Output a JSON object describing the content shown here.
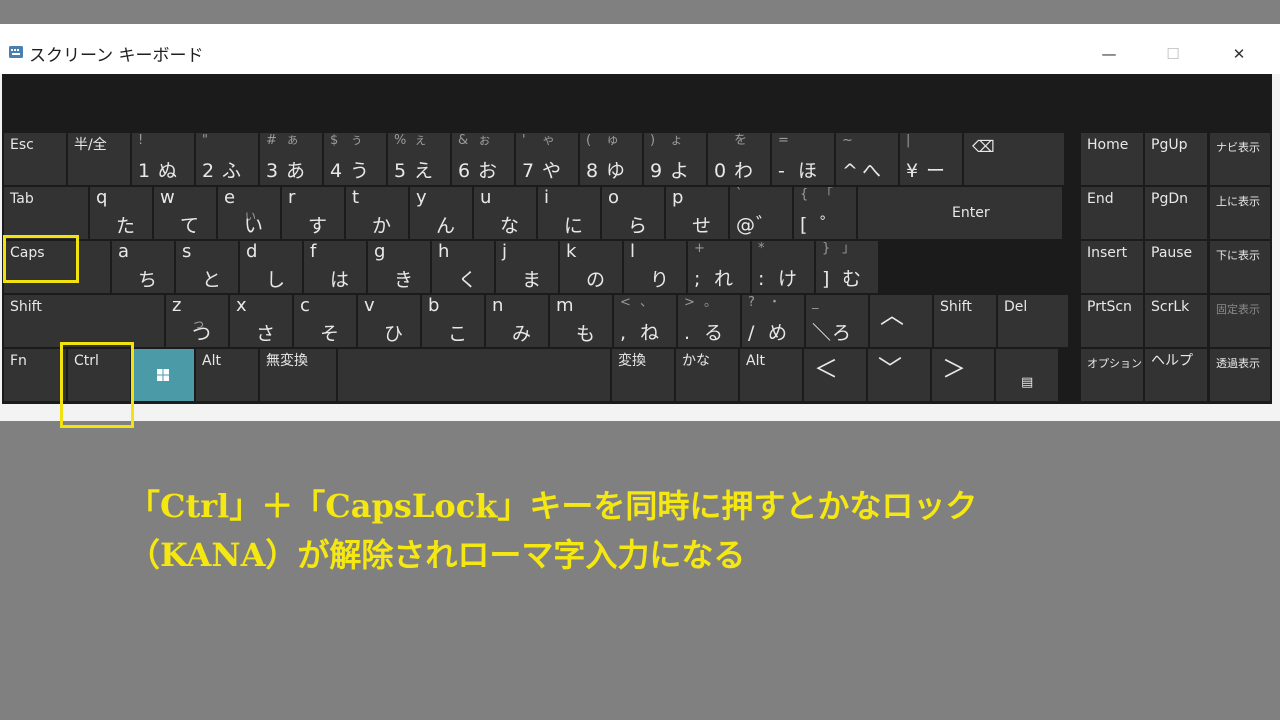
{
  "window": {
    "title": "スクリーン キーボード",
    "minimize_glyph": "—",
    "maximize_glyph": "☐",
    "close_glyph": "✕"
  },
  "colors": {
    "key_bg": "#333333",
    "windows_key_bg": "#4a9aa8",
    "highlight": "#f1e210",
    "caption": "#f5e712"
  },
  "keyboard": {
    "row1": [
      {
        "label": "Esc"
      },
      {
        "label": "半/全"
      },
      {
        "tl": "!",
        "main": "1",
        "kana": "ぬ"
      },
      {
        "tl": "\"",
        "main": "2",
        "kana": "ふ"
      },
      {
        "tl": "#",
        "tr": "ぁ",
        "main": "3",
        "kana": "あ"
      },
      {
        "tl": "$",
        "tr": "ぅ",
        "main": "4",
        "kana": "う"
      },
      {
        "tl": "%",
        "tr": "ぇ",
        "main": "5",
        "kana": "え"
      },
      {
        "tl": "&",
        "tr": "ぉ",
        "main": "6",
        "kana": "お"
      },
      {
        "tl": "'",
        "tr": "ゃ",
        "main": "7",
        "kana": "や"
      },
      {
        "tl": "(",
        "tr": "ゅ",
        "main": "8",
        "kana": "ゆ"
      },
      {
        "tl": ")",
        "tr": "ょ",
        "main": "9",
        "kana": "よ"
      },
      {
        "tr": "を",
        "main": "0",
        "kana": "わ"
      },
      {
        "tl": "=",
        "main": "-",
        "kana": "ほ"
      },
      {
        "tl": "~",
        "main": "^",
        "kana": "へ"
      },
      {
        "tl": "|",
        "main": "¥",
        "kana": "ー"
      },
      {
        "icon": "backspace-icon",
        "glyph": "⌫"
      }
    ],
    "row2": [
      {
        "label": "Tab"
      },
      {
        "top": "q",
        "kana": "た"
      },
      {
        "top": "w",
        "kana": "て"
      },
      {
        "top": "e",
        "sub": "ぃ",
        "kana": "い"
      },
      {
        "top": "r",
        "kana": "す"
      },
      {
        "top": "t",
        "kana": "か"
      },
      {
        "top": "y",
        "kana": "ん"
      },
      {
        "top": "u",
        "kana": "な"
      },
      {
        "top": "i",
        "kana": "に"
      },
      {
        "top": "o",
        "kana": "ら"
      },
      {
        "top": "p",
        "kana": "せ"
      },
      {
        "tl": "`",
        "main": "@",
        "kana": "゛"
      },
      {
        "tl": "{",
        "tr": "「",
        "main": "[",
        "kana": "゜"
      },
      {
        "label": "Enter"
      }
    ],
    "row3": [
      {
        "label": "Caps"
      },
      {
        "top": "a",
        "kana": "ち"
      },
      {
        "top": "s",
        "kana": "と"
      },
      {
        "top": "d",
        "kana": "し"
      },
      {
        "top": "f",
        "kana": "は"
      },
      {
        "top": "g",
        "kana": "き"
      },
      {
        "top": "h",
        "kana": "く"
      },
      {
        "top": "j",
        "kana": "ま"
      },
      {
        "top": "k",
        "kana": "の"
      },
      {
        "top": "l",
        "kana": "り"
      },
      {
        "tl": "+",
        "main": ";",
        "kana": "れ"
      },
      {
        "tl": "*",
        "main": ":",
        "kana": "け"
      },
      {
        "tl": "}",
        "tr": "」",
        "main": "]",
        "kana": "む"
      }
    ],
    "row4": [
      {
        "label": "Shift"
      },
      {
        "top": "z",
        "sub": "っ",
        "kana": "つ"
      },
      {
        "top": "x",
        "kana": "さ"
      },
      {
        "top": "c",
        "kana": "そ"
      },
      {
        "top": "v",
        "kana": "ひ"
      },
      {
        "top": "b",
        "kana": "こ"
      },
      {
        "top": "n",
        "kana": "み"
      },
      {
        "top": "m",
        "kana": "も"
      },
      {
        "tl": "<",
        "tr": "、",
        "main": ",",
        "kana": "ね"
      },
      {
        "tl": ">",
        "tr": "。",
        "main": ".",
        "kana": "る"
      },
      {
        "tl": "?",
        "tr": "・",
        "main": "/",
        "kana": "め"
      },
      {
        "tl": "_",
        "main": "＼",
        "kana": "ろ"
      },
      {
        "icon": "arrow-up-icon",
        "glyph": "︿"
      },
      {
        "label": "Shift"
      },
      {
        "label": "Del"
      }
    ],
    "row5": [
      {
        "label": "Fn"
      },
      {
        "label": "Ctrl"
      },
      {
        "icon": "windows-icon"
      },
      {
        "label": "Alt"
      },
      {
        "label": "無変換"
      },
      {
        "label": ""
      },
      {
        "label": "変換"
      },
      {
        "label": "かな"
      },
      {
        "label": "Alt"
      },
      {
        "icon": "arrow-left-icon",
        "glyph": "＜"
      },
      {
        "icon": "arrow-down-icon",
        "glyph": "﹀"
      },
      {
        "icon": "arrow-right-icon",
        "glyph": "＞"
      },
      {
        "icon": "context-menu-icon",
        "glyph": "▤"
      }
    ],
    "nav": [
      {
        "label": "Home"
      },
      {
        "label": "PgUp"
      },
      {
        "label": "ナビ表示"
      },
      {
        "label": "End"
      },
      {
        "label": "PgDn"
      },
      {
        "label": "上に表示"
      },
      {
        "label": "Insert"
      },
      {
        "label": "Pause"
      },
      {
        "label": "下に表示"
      },
      {
        "label": "PrtScn"
      },
      {
        "label": "ScrLk"
      },
      {
        "label": "固定表示"
      },
      {
        "label": "オプション"
      },
      {
        "label": "ヘルプ"
      },
      {
        "label": "透過表示"
      }
    ]
  },
  "caption": {
    "line1": "「Ctrl」＋「CapsLock」キーを同時に押すとかなロック",
    "line2": "（KANA）が解除されローマ字入力になる"
  }
}
